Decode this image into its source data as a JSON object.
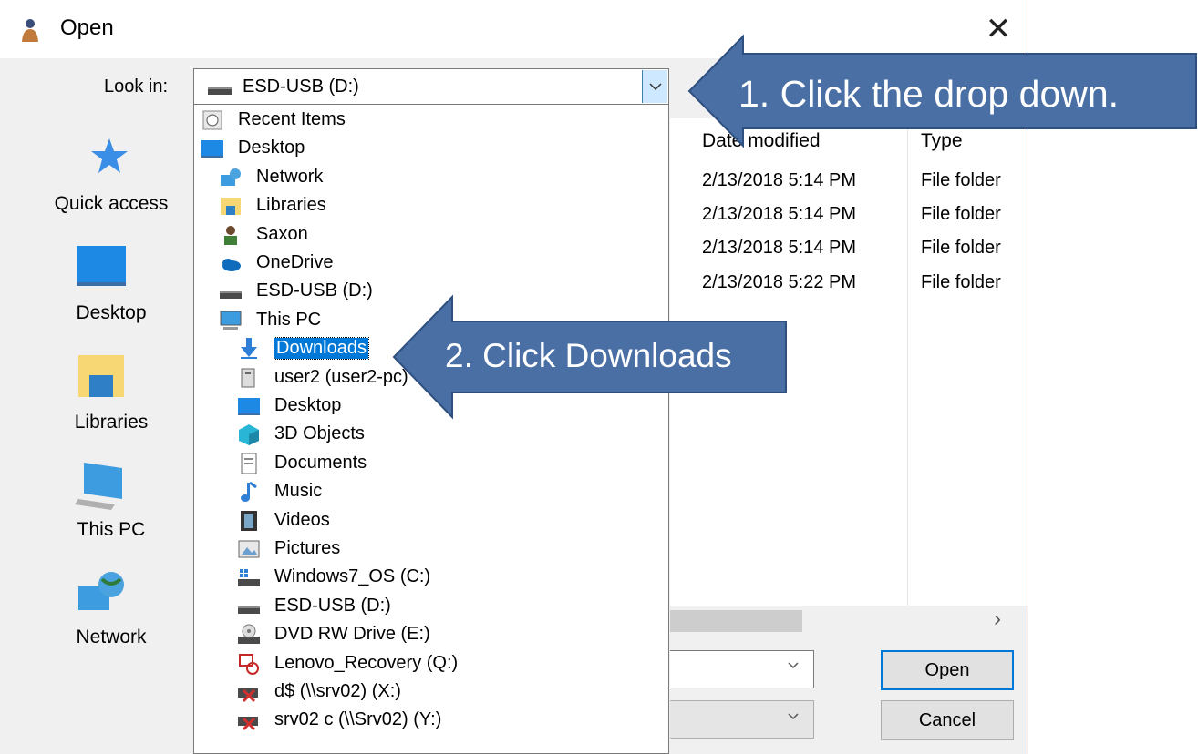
{
  "dialog": {
    "title": "Open",
    "close_glyph": "✕",
    "look_in_label": "Look in:",
    "look_in_value": "ESD-USB (D:)"
  },
  "places": [
    {
      "label": "Quick access",
      "icon": "star-icon"
    },
    {
      "label": "Desktop",
      "icon": "desktop-icon"
    },
    {
      "label": "Libraries",
      "icon": "libraries-icon"
    },
    {
      "label": "This PC",
      "icon": "computer-icon"
    },
    {
      "label": "Network",
      "icon": "network-icon"
    }
  ],
  "file_list": {
    "columns": {
      "date": "Date modified",
      "type": "Type"
    },
    "rows": [
      {
        "date": "2/13/2018 5:14 PM",
        "type": "File folder"
      },
      {
        "date": "2/13/2018 5:14 PM",
        "type": "File folder"
      },
      {
        "date": "2/13/2018 5:14 PM",
        "type": "File folder"
      },
      {
        "date": "2/13/2018 5:22 PM",
        "type": "File folder"
      }
    ],
    "scroll_right_glyph": "›"
  },
  "dropdown": {
    "items": [
      {
        "label": "Recent Items",
        "icon": "recent-items-icon",
        "level": 0
      },
      {
        "label": "Desktop",
        "icon": "desktop-icon",
        "level": 0
      },
      {
        "label": "Network",
        "icon": "network-icon",
        "level": 1
      },
      {
        "label": "Libraries",
        "icon": "libraries-icon",
        "level": 1
      },
      {
        "label": "Saxon",
        "icon": "user-icon",
        "level": 1
      },
      {
        "label": "OneDrive",
        "icon": "onedrive-icon",
        "level": 1
      },
      {
        "label": "ESD-USB (D:)",
        "icon": "drive-icon",
        "level": 1
      },
      {
        "label": "This PC",
        "icon": "computer-icon",
        "level": 1
      },
      {
        "label": "Downloads",
        "icon": "downloads-icon",
        "level": 2,
        "selected": true
      },
      {
        "label": "user2 (user2-pc)",
        "icon": "network-share-icon",
        "level": 2
      },
      {
        "label": "Desktop",
        "icon": "desktop-icon",
        "level": 2
      },
      {
        "label": "3D Objects",
        "icon": "3d-objects-icon",
        "level": 2
      },
      {
        "label": "Documents",
        "icon": "documents-icon",
        "level": 2
      },
      {
        "label": "Music",
        "icon": "music-icon",
        "level": 2
      },
      {
        "label": "Videos",
        "icon": "videos-icon",
        "level": 2
      },
      {
        "label": "Pictures",
        "icon": "pictures-icon",
        "level": 2
      },
      {
        "label": "Windows7_OS (C:)",
        "icon": "os-drive-icon",
        "level": 2
      },
      {
        "label": "ESD-USB (D:)",
        "icon": "drive-icon",
        "level": 2
      },
      {
        "label": "DVD RW Drive (E:)",
        "icon": "dvd-drive-icon",
        "level": 2
      },
      {
        "label": "Lenovo_Recovery (Q:)",
        "icon": "recovery-drive-icon",
        "level": 2
      },
      {
        "label": "d$ (\\\\srv02) (X:)",
        "icon": "disconnected-drive-icon",
        "level": 2
      },
      {
        "label": "srv02 c (\\\\Srv02) (Y:)",
        "icon": "disconnected-drive-icon",
        "level": 2
      }
    ]
  },
  "buttons": {
    "open": "Open",
    "cancel": "Cancel"
  },
  "callouts": [
    {
      "text": "1. Click the drop down."
    },
    {
      "text": "2. Click Downloads"
    }
  ],
  "colors": {
    "callout_fill": "#4a6fa5",
    "callout_stroke": "#2f4f7f",
    "selection": "#0078d7"
  }
}
